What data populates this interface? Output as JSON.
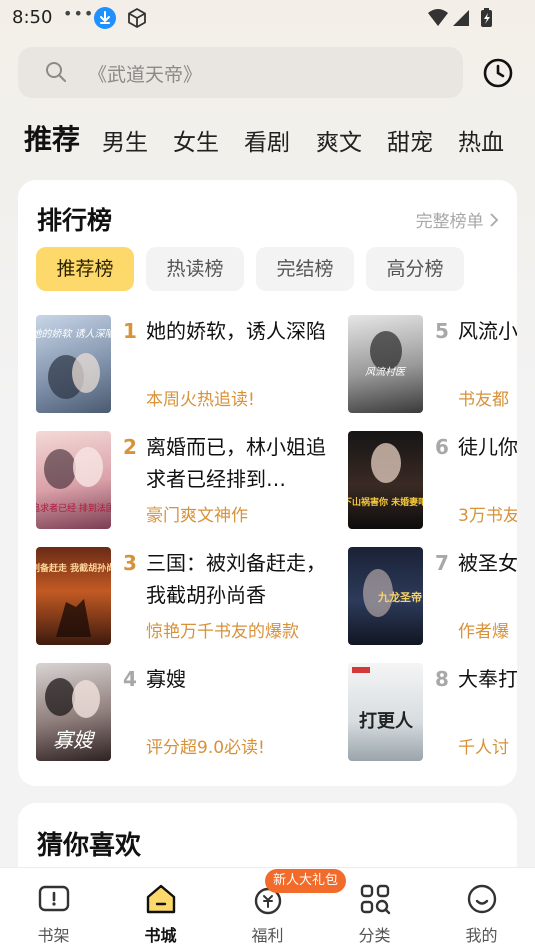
{
  "status_bar": {
    "time": "8:50",
    "dots": "•••"
  },
  "search": {
    "placeholder": "《武道天帝》"
  },
  "category_tabs": [
    "推荐",
    "男生",
    "女生",
    "看剧",
    "爽文",
    "甜宠",
    "热血"
  ],
  "ranking": {
    "title": "排行榜",
    "more_label": "完整榜单",
    "sub_tabs": [
      "推荐榜",
      "热读榜",
      "完结榜",
      "高分榜"
    ],
    "books": [
      {
        "rank": "1",
        "title": "她的娇软，诱人深陷",
        "tag": "本周火热追读!",
        "cover_text": "她的娇软 诱人深陷"
      },
      {
        "rank": "2",
        "title": "离婚而已，林小姐追求者已经排到…",
        "tag": "豪门爽文神作",
        "cover_text": "追求者已经 排到法国"
      },
      {
        "rank": "3",
        "title": "三国：被刘备赶走，我截胡孙尚香",
        "tag": "惊艳万千书友的爆款",
        "cover_text": "被刘备赶走 我截胡孙尚香"
      },
      {
        "rank": "4",
        "title": "寡嫂",
        "tag": "评分超9.0必读!",
        "cover_text": "寡嫂"
      },
      {
        "rank": "5",
        "title": "风流小",
        "tag": "书友都",
        "cover_text": "风流村医"
      },
      {
        "rank": "6",
        "title": "徒儿你山祸害",
        "tag": "3万书友",
        "cover_text": "下山祸害你 未婚妻吧"
      },
      {
        "rank": "7",
        "title": "被圣女次后，",
        "tag": "作者爆",
        "cover_text": "九龙圣帝"
      },
      {
        "rank": "8",
        "title": "大奉打",
        "tag": "千人讨",
        "cover_text": "打更人"
      }
    ]
  },
  "guess": {
    "title": "猜你喜欢"
  },
  "bottom_nav": {
    "items": [
      "书架",
      "书城",
      "福利",
      "分类",
      "我的"
    ],
    "badge": "新人大礼包"
  },
  "colors": {
    "accent": "#fcd96a",
    "tag": "#d7923a",
    "rank_top": "#d7923a",
    "rank_other": "#a8a8a8",
    "badge": "#f26b2b"
  }
}
